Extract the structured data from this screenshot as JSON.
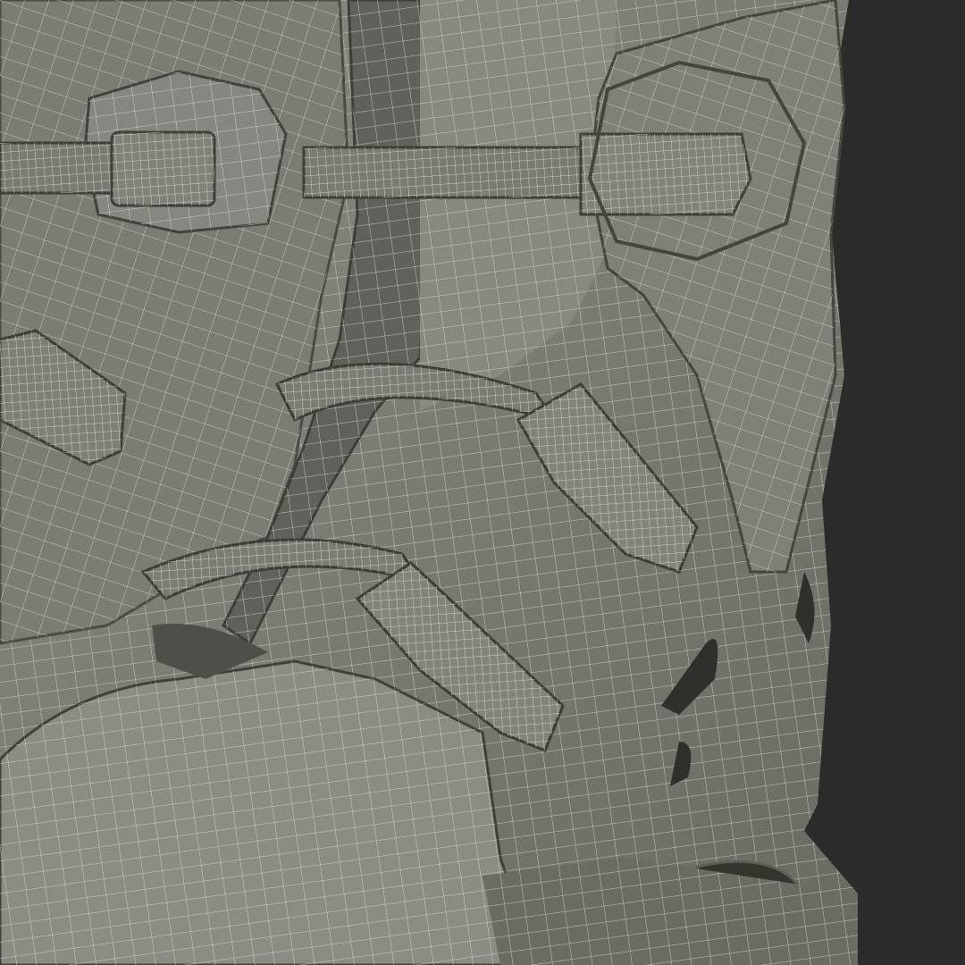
{
  "scene": {
    "subject": "boot-wireframe-render",
    "colors": {
      "background": "#2b2b2b",
      "surface": "#76786f",
      "surface_light": "#8a8c82",
      "surface_dark": "#5d5f57",
      "wire": "#e6e4d6",
      "shadow": "#34352f"
    }
  }
}
